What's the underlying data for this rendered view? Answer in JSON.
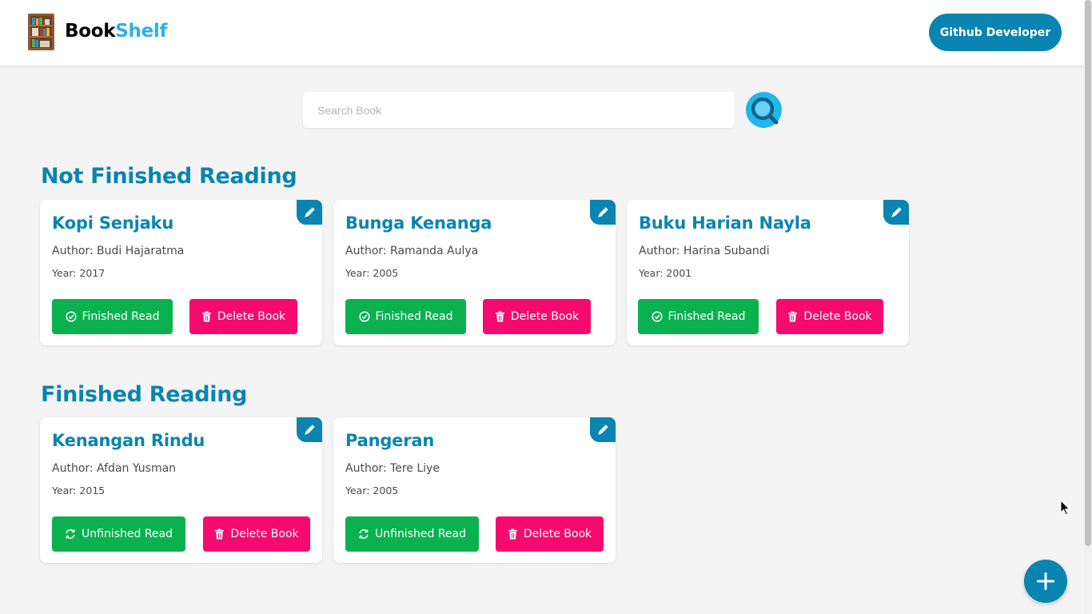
{
  "header": {
    "brand_part1": "Book",
    "brand_part2": "Shelf",
    "github_button": "Github Developer",
    "logo_icon": "bookshelf-icon"
  },
  "search": {
    "placeholder": "Search Book",
    "value": "",
    "button_icon": "search-icon"
  },
  "sections": {
    "unfinished": {
      "title": "Not Finished Reading",
      "books": [
        {
          "title": "Kopi Senjaku",
          "author": "Author: Budi Hajaratma",
          "year": "Year: 2017",
          "action_label": "Finished Read",
          "delete_label": "Delete Book"
        },
        {
          "title": "Bunga Kenanga",
          "author": "Author: Ramanda Aulya",
          "year": "Year: 2005",
          "action_label": "Finished Read",
          "delete_label": "Delete Book"
        },
        {
          "title": "Buku Harian Nayla",
          "author": "Author: Harina Subandi",
          "year": "Year: 2001",
          "action_label": "Finished Read",
          "delete_label": "Delete Book"
        }
      ]
    },
    "finished": {
      "title": "Finished Reading",
      "books": [
        {
          "title": "Kenangan Rindu",
          "author": "Author: Afdan Yusman",
          "year": "Year: 2015",
          "action_label": "Unfinished Read",
          "delete_label": "Delete Book"
        },
        {
          "title": "Pangeran",
          "author": "Author: Tere Liye",
          "year": "Year: 2005",
          "action_label": "Unfinished Read",
          "delete_label": "Delete Book"
        }
      ]
    }
  },
  "colors": {
    "primary": "#0a84b0",
    "accent": "#2bb1e6",
    "success": "#0bb14f",
    "danger": "#f50a6f",
    "background": "#f4f4f4"
  },
  "icons": {
    "edit": "pen-icon",
    "finish": "check-circle-icon",
    "unfinish": "refresh-icon",
    "delete": "trash-icon",
    "add": "plus-icon"
  }
}
